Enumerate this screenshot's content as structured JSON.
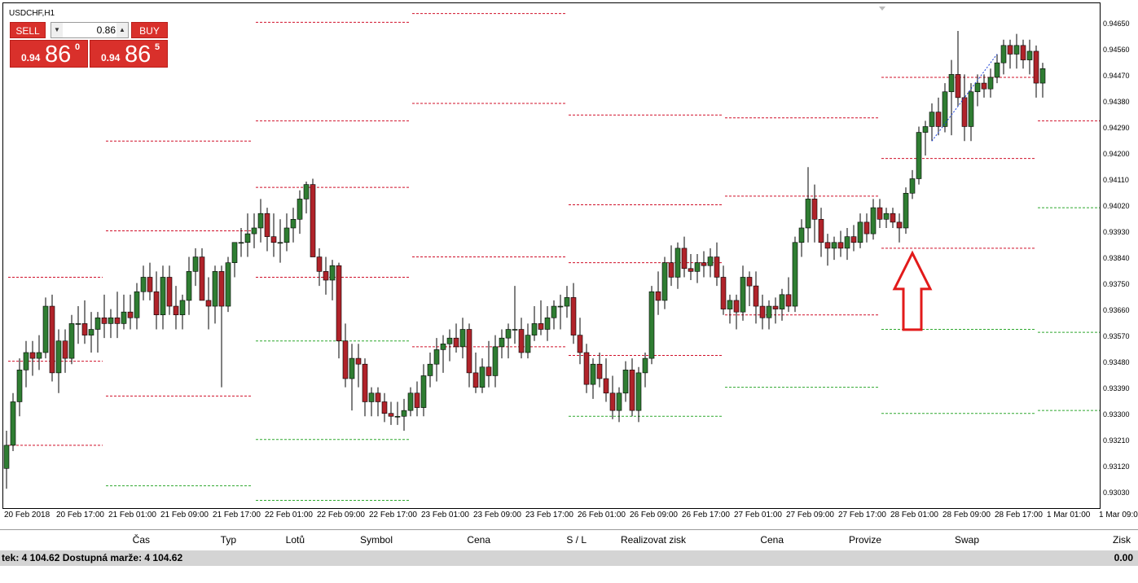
{
  "chart": {
    "symbol_label": "USDCHF,H1",
    "colors": {
      "bull": "#2f7d32",
      "bear": "#b0232a",
      "wick": "#000000",
      "level_red": "#d0102a",
      "level_green": "#2ea82e",
      "arrow": "#e21a1a",
      "trend": "#1a3fd8"
    },
    "price_min": 0.93,
    "price_max": 0.9472,
    "price_ticks": [
      "0.94650",
      "0.94560",
      "0.94470",
      "0.94380",
      "0.94290",
      "0.94200",
      "0.94110",
      "0.94020",
      "0.93930",
      "0.93840",
      "0.93750",
      "0.93660",
      "0.93570",
      "0.93480",
      "0.93390",
      "0.93300",
      "0.93210",
      "0.93120",
      "0.93030"
    ],
    "time_labels": [
      "20 Feb 2018",
      "20 Feb 17:00",
      "21 Feb 01:00",
      "21 Feb 09:00",
      "21 Feb 17:00",
      "22 Feb 01:00",
      "22 Feb 09:00",
      "22 Feb 17:00",
      "23 Feb 01:00",
      "23 Feb 09:00",
      "23 Feb 17:00",
      "26 Feb 01:00",
      "26 Feb 09:00",
      "26 Feb 17:00",
      "27 Feb 01:00",
      "27 Feb 09:00",
      "27 Feb 17:00",
      "28 Feb 01:00",
      "28 Feb 09:00",
      "28 Feb 17:00",
      "1 Mar 01:00",
      "1 Mar 09:00"
    ],
    "candles": [
      [
        0.9312,
        0.9325,
        0.9305,
        0.932
      ],
      [
        0.932,
        0.9338,
        0.9318,
        0.9335
      ],
      [
        0.9335,
        0.935,
        0.933,
        0.9346
      ],
      [
        0.9346,
        0.9356,
        0.934,
        0.9352
      ],
      [
        0.9352,
        0.9356,
        0.9344,
        0.935
      ],
      [
        0.935,
        0.9358,
        0.9346,
        0.9352
      ],
      [
        0.9352,
        0.9371,
        0.935,
        0.9368
      ],
      [
        0.9368,
        0.9372,
        0.9342,
        0.9345
      ],
      [
        0.9345,
        0.936,
        0.9338,
        0.9356
      ],
      [
        0.9356,
        0.936,
        0.9345,
        0.935
      ],
      [
        0.935,
        0.9365,
        0.9348,
        0.9362
      ],
      [
        0.9362,
        0.9368,
        0.9355,
        0.9362
      ],
      [
        0.9362,
        0.937,
        0.9355,
        0.9358
      ],
      [
        0.9358,
        0.9366,
        0.9352,
        0.936
      ],
      [
        0.936,
        0.9366,
        0.9352,
        0.9364
      ],
      [
        0.9364,
        0.9372,
        0.9357,
        0.9362
      ],
      [
        0.9362,
        0.9367,
        0.9357,
        0.9364
      ],
      [
        0.9364,
        0.9373,
        0.9357,
        0.9362
      ],
      [
        0.9362,
        0.9372,
        0.936,
        0.9366
      ],
      [
        0.9366,
        0.9372,
        0.936,
        0.9364
      ],
      [
        0.9364,
        0.9376,
        0.936,
        0.9373
      ],
      [
        0.9373,
        0.9382,
        0.937,
        0.9378
      ],
      [
        0.9378,
        0.9383,
        0.937,
        0.9373
      ],
      [
        0.9373,
        0.938,
        0.936,
        0.9365
      ],
      [
        0.9365,
        0.9382,
        0.936,
        0.9378
      ],
      [
        0.9378,
        0.9382,
        0.9365,
        0.9368
      ],
      [
        0.9368,
        0.9375,
        0.936,
        0.9365
      ],
      [
        0.9365,
        0.9372,
        0.936,
        0.937
      ],
      [
        0.937,
        0.9385,
        0.9365,
        0.938
      ],
      [
        0.938,
        0.9388,
        0.9375,
        0.9385
      ],
      [
        0.9385,
        0.9388,
        0.937,
        0.937
      ],
      [
        0.937,
        0.9378,
        0.936,
        0.9368
      ],
      [
        0.9368,
        0.9382,
        0.9362,
        0.938
      ],
      [
        0.938,
        0.9382,
        0.934,
        0.9368
      ],
      [
        0.9368,
        0.9385,
        0.9366,
        0.9383
      ],
      [
        0.9383,
        0.939,
        0.9378,
        0.939
      ],
      [
        0.939,
        0.9395,
        0.9385,
        0.939
      ],
      [
        0.939,
        0.94,
        0.9385,
        0.9393
      ],
      [
        0.9393,
        0.94,
        0.9388,
        0.9395
      ],
      [
        0.9395,
        0.9405,
        0.939,
        0.94
      ],
      [
        0.94,
        0.9402,
        0.9387,
        0.9392
      ],
      [
        0.9392,
        0.94,
        0.9385,
        0.939
      ],
      [
        0.939,
        0.9398,
        0.9383,
        0.939
      ],
      [
        0.939,
        0.94,
        0.9387,
        0.9395
      ],
      [
        0.9395,
        0.9402,
        0.939,
        0.9398
      ],
      [
        0.9398,
        0.9408,
        0.9393,
        0.9405
      ],
      [
        0.9405,
        0.9411,
        0.94,
        0.941
      ],
      [
        0.941,
        0.9412,
        0.9385,
        0.9385
      ],
      [
        0.9385,
        0.9388,
        0.9375,
        0.938
      ],
      [
        0.938,
        0.9385,
        0.9372,
        0.9377
      ],
      [
        0.9377,
        0.9384,
        0.937,
        0.9382
      ],
      [
        0.9382,
        0.9383,
        0.935,
        0.9356
      ],
      [
        0.9356,
        0.9362,
        0.934,
        0.9343
      ],
      [
        0.9343,
        0.9355,
        0.9332,
        0.935
      ],
      [
        0.935,
        0.9355,
        0.934,
        0.9348
      ],
      [
        0.9348,
        0.935,
        0.933,
        0.9335
      ],
      [
        0.9335,
        0.934,
        0.933,
        0.9338
      ],
      [
        0.9338,
        0.934,
        0.933,
        0.9335
      ],
      [
        0.9335,
        0.9338,
        0.9328,
        0.9331
      ],
      [
        0.9331,
        0.9335,
        0.9327,
        0.933
      ],
      [
        0.933,
        0.9335,
        0.9327,
        0.933
      ],
      [
        0.933,
        0.9336,
        0.9325,
        0.9332
      ],
      [
        0.9332,
        0.934,
        0.933,
        0.9338
      ],
      [
        0.9338,
        0.9342,
        0.933,
        0.9333
      ],
      [
        0.9333,
        0.9348,
        0.933,
        0.9344
      ],
      [
        0.9344,
        0.9352,
        0.934,
        0.9348
      ],
      [
        0.9348,
        0.9357,
        0.9342,
        0.9353
      ],
      [
        0.9353,
        0.9358,
        0.9345,
        0.9355
      ],
      [
        0.9355,
        0.936,
        0.9349,
        0.9357
      ],
      [
        0.9357,
        0.9362,
        0.9352,
        0.9354
      ],
      [
        0.9354,
        0.9364,
        0.935,
        0.936
      ],
      [
        0.936,
        0.9362,
        0.934,
        0.9345
      ],
      [
        0.9345,
        0.9352,
        0.9338,
        0.934
      ],
      [
        0.934,
        0.935,
        0.9338,
        0.9347
      ],
      [
        0.9347,
        0.9356,
        0.934,
        0.9344
      ],
      [
        0.9344,
        0.9358,
        0.934,
        0.9354
      ],
      [
        0.9354,
        0.936,
        0.935,
        0.9357
      ],
      [
        0.9357,
        0.9362,
        0.935,
        0.936
      ],
      [
        0.936,
        0.9375,
        0.9355,
        0.936
      ],
      [
        0.936,
        0.9364,
        0.935,
        0.9352
      ],
      [
        0.9352,
        0.9362,
        0.935,
        0.9358
      ],
      [
        0.9358,
        0.9368,
        0.9356,
        0.9362
      ],
      [
        0.9362,
        0.937,
        0.9358,
        0.936
      ],
      [
        0.936,
        0.9368,
        0.9356,
        0.9364
      ],
      [
        0.9364,
        0.937,
        0.936,
        0.9368
      ],
      [
        0.9368,
        0.9372,
        0.936,
        0.9368
      ],
      [
        0.9368,
        0.9375,
        0.9364,
        0.9371
      ],
      [
        0.9371,
        0.9376,
        0.9355,
        0.9358
      ],
      [
        0.9358,
        0.9364,
        0.9348,
        0.9352
      ],
      [
        0.9352,
        0.9355,
        0.9338,
        0.9341
      ],
      [
        0.9341,
        0.935,
        0.9336,
        0.9348
      ],
      [
        0.9348,
        0.9352,
        0.934,
        0.9343
      ],
      [
        0.9343,
        0.935,
        0.9335,
        0.9338
      ],
      [
        0.9338,
        0.9344,
        0.9329,
        0.9332
      ],
      [
        0.9332,
        0.934,
        0.9328,
        0.9338
      ],
      [
        0.9338,
        0.9349,
        0.9335,
        0.9346
      ],
      [
        0.9346,
        0.935,
        0.933,
        0.9332
      ],
      [
        0.9332,
        0.9347,
        0.9328,
        0.9345
      ],
      [
        0.9345,
        0.9352,
        0.934,
        0.935
      ],
      [
        0.935,
        0.9375,
        0.9348,
        0.9373
      ],
      [
        0.9373,
        0.938,
        0.9365,
        0.937
      ],
      [
        0.937,
        0.9385,
        0.9367,
        0.9383
      ],
      [
        0.9383,
        0.9389,
        0.9375,
        0.9378
      ],
      [
        0.9378,
        0.939,
        0.9374,
        0.9388
      ],
      [
        0.9388,
        0.9392,
        0.9378,
        0.9381
      ],
      [
        0.9381,
        0.9386,
        0.9377,
        0.938
      ],
      [
        0.938,
        0.9386,
        0.9376,
        0.9383
      ],
      [
        0.9383,
        0.9387,
        0.9378,
        0.9382
      ],
      [
        0.9382,
        0.9388,
        0.9378,
        0.9385
      ],
      [
        0.9385,
        0.939,
        0.9375,
        0.9378
      ],
      [
        0.9378,
        0.9382,
        0.9365,
        0.9367
      ],
      [
        0.9367,
        0.9372,
        0.9362,
        0.937
      ],
      [
        0.937,
        0.9372,
        0.936,
        0.9366
      ],
      [
        0.9366,
        0.9382,
        0.9363,
        0.9378
      ],
      [
        0.9378,
        0.938,
        0.9368,
        0.9375
      ],
      [
        0.9375,
        0.938,
        0.9362,
        0.9368
      ],
      [
        0.9368,
        0.9372,
        0.936,
        0.9364
      ],
      [
        0.9364,
        0.937,
        0.936,
        0.9368
      ],
      [
        0.9368,
        0.9371,
        0.9362,
        0.9367
      ],
      [
        0.9367,
        0.9374,
        0.9363,
        0.9372
      ],
      [
        0.9372,
        0.9378,
        0.9366,
        0.9368
      ],
      [
        0.9368,
        0.9392,
        0.9366,
        0.939
      ],
      [
        0.939,
        0.9398,
        0.9385,
        0.9395
      ],
      [
        0.9395,
        0.9416,
        0.939,
        0.9405
      ],
      [
        0.9405,
        0.941,
        0.939,
        0.9398
      ],
      [
        0.9398,
        0.9402,
        0.9385,
        0.939
      ],
      [
        0.939,
        0.9393,
        0.9382,
        0.9388
      ],
      [
        0.9388,
        0.9392,
        0.9384,
        0.939
      ],
      [
        0.939,
        0.9394,
        0.9385,
        0.9388
      ],
      [
        0.9388,
        0.9395,
        0.9384,
        0.9392
      ],
      [
        0.9392,
        0.9396,
        0.9387,
        0.939
      ],
      [
        0.939,
        0.94,
        0.9388,
        0.9397
      ],
      [
        0.9397,
        0.94,
        0.939,
        0.9393
      ],
      [
        0.9393,
        0.9405,
        0.9391,
        0.9402
      ],
      [
        0.9402,
        0.9405,
        0.9395,
        0.9398
      ],
      [
        0.9398,
        0.9402,
        0.9395,
        0.94
      ],
      [
        0.94,
        0.9402,
        0.9395,
        0.9397
      ],
      [
        0.9397,
        0.94,
        0.939,
        0.9395
      ],
      [
        0.9395,
        0.9409,
        0.9393,
        0.9407
      ],
      [
        0.9407,
        0.9415,
        0.9405,
        0.9412
      ],
      [
        0.9412,
        0.943,
        0.941,
        0.9428
      ],
      [
        0.9428,
        0.9432,
        0.942,
        0.943
      ],
      [
        0.943,
        0.9438,
        0.9425,
        0.9435
      ],
      [
        0.9435,
        0.944,
        0.9427,
        0.943
      ],
      [
        0.943,
        0.9445,
        0.9428,
        0.9442
      ],
      [
        0.9442,
        0.9453,
        0.9427,
        0.9448
      ],
      [
        0.9448,
        0.9463,
        0.9437,
        0.944
      ],
      [
        0.944,
        0.9448,
        0.9425,
        0.943
      ],
      [
        0.943,
        0.9445,
        0.9425,
        0.9442
      ],
      [
        0.9442,
        0.9448,
        0.9437,
        0.9445
      ],
      [
        0.9445,
        0.9448,
        0.944,
        0.9443
      ],
      [
        0.9443,
        0.945,
        0.944,
        0.9447
      ],
      [
        0.9447,
        0.9455,
        0.9445,
        0.9452
      ],
      [
        0.9452,
        0.946,
        0.9448,
        0.9458
      ],
      [
        0.9458,
        0.946,
        0.945,
        0.9455
      ],
      [
        0.9455,
        0.9462,
        0.945,
        0.9458
      ],
      [
        0.9458,
        0.946,
        0.945,
        0.9453
      ],
      [
        0.9453,
        0.946,
        0.9448,
        0.9456
      ],
      [
        0.9456,
        0.9458,
        0.944,
        0.9445
      ],
      [
        0.9445,
        0.9452,
        0.944,
        0.945
      ]
    ],
    "levels": [
      {
        "from": 0,
        "to": 14,
        "price": 0.9378,
        "kind": "red"
      },
      {
        "from": 0,
        "to": 14,
        "price": 0.9349,
        "kind": "red"
      },
      {
        "from": 0,
        "to": 14,
        "price": 0.932,
        "kind": "red"
      },
      {
        "from": 15,
        "to": 37,
        "price": 0.9425,
        "kind": "red"
      },
      {
        "from": 15,
        "to": 37,
        "price": 0.9394,
        "kind": "red"
      },
      {
        "from": 15,
        "to": 37,
        "price": 0.9337,
        "kind": "red"
      },
      {
        "from": 15,
        "to": 37,
        "price": 0.9306,
        "kind": "green"
      },
      {
        "from": 38,
        "to": 61,
        "price": 0.9466,
        "kind": "red"
      },
      {
        "from": 38,
        "to": 61,
        "price": 0.9432,
        "kind": "red"
      },
      {
        "from": 38,
        "to": 61,
        "price": 0.9409,
        "kind": "red"
      },
      {
        "from": 38,
        "to": 61,
        "price": 0.9378,
        "kind": "red"
      },
      {
        "from": 38,
        "to": 61,
        "price": 0.9356,
        "kind": "green"
      },
      {
        "from": 38,
        "to": 61,
        "price": 0.9322,
        "kind": "green"
      },
      {
        "from": 38,
        "to": 61,
        "price": 0.9301,
        "kind": "green"
      },
      {
        "from": 62,
        "to": 85,
        "price": 0.9469,
        "kind": "red"
      },
      {
        "from": 62,
        "to": 85,
        "price": 0.9438,
        "kind": "red"
      },
      {
        "from": 62,
        "to": 85,
        "price": 0.9385,
        "kind": "red"
      },
      {
        "from": 62,
        "to": 85,
        "price": 0.9354,
        "kind": "red"
      },
      {
        "from": 86,
        "to": 109,
        "price": 0.9434,
        "kind": "red"
      },
      {
        "from": 86,
        "to": 109,
        "price": 0.9403,
        "kind": "red"
      },
      {
        "from": 86,
        "to": 109,
        "price": 0.9383,
        "kind": "red"
      },
      {
        "from": 86,
        "to": 109,
        "price": 0.9351,
        "kind": "red"
      },
      {
        "from": 86,
        "to": 109,
        "price": 0.933,
        "kind": "green"
      },
      {
        "from": 110,
        "to": 133,
        "price": 0.9433,
        "kind": "red"
      },
      {
        "from": 110,
        "to": 133,
        "price": 0.9406,
        "kind": "red"
      },
      {
        "from": 110,
        "to": 133,
        "price": 0.9365,
        "kind": "red"
      },
      {
        "from": 110,
        "to": 133,
        "price": 0.934,
        "kind": "green"
      },
      {
        "from": 134,
        "to": 157,
        "price": 0.9447,
        "kind": "red"
      },
      {
        "from": 134,
        "to": 157,
        "price": 0.9419,
        "kind": "red"
      },
      {
        "from": 134,
        "to": 157,
        "price": 0.9388,
        "kind": "red"
      },
      {
        "from": 134,
        "to": 157,
        "price": 0.936,
        "kind": "green"
      },
      {
        "from": 134,
        "to": 157,
        "price": 0.9331,
        "kind": "green"
      },
      {
        "from": 158,
        "to": 168,
        "price": 0.9432,
        "kind": "red"
      },
      {
        "from": 158,
        "to": 168,
        "price": 0.9402,
        "kind": "green"
      },
      {
        "from": 158,
        "to": 168,
        "price": 0.9359,
        "kind": "green"
      },
      {
        "from": 158,
        "to": 168,
        "price": 0.9332,
        "kind": "green"
      }
    ]
  },
  "trade_panel": {
    "sell_label": "SELL",
    "buy_label": "BUY",
    "lot_value": "0.86",
    "sell_prefix": "0.94",
    "sell_big": "86",
    "sell_sup": "0",
    "buy_prefix": "0.94",
    "buy_big": "86",
    "buy_sup": "5"
  },
  "terminal": {
    "columns": [
      "Čas",
      "Typ",
      "Lotů",
      "Symbol",
      "Cena",
      "S / L",
      "Realizovat zisk",
      "Cena",
      "Provize",
      "Swap",
      "Zisk"
    ],
    "balance_text": "tek: 4 104.62  Dostupná marže: 4 104.62",
    "total_profit": "0.00"
  }
}
